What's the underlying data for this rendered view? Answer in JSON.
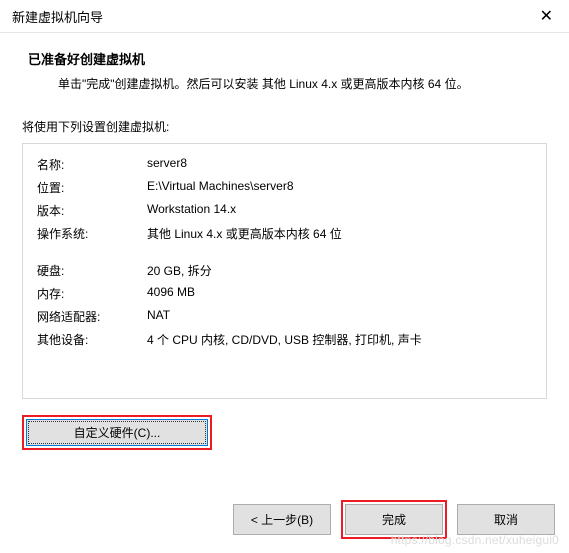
{
  "titlebar": {
    "title": "新建虚拟机向导",
    "close": "✕"
  },
  "header": {
    "title": "已准备好创建虚拟机",
    "desc": "单击\"完成\"创建虚拟机。然后可以安装 其他 Linux 4.x 或更高版本内核 64 位。"
  },
  "section_label": "将使用下列设置创建虚拟机:",
  "info": {
    "rows1": [
      {
        "label": "名称:",
        "value": "server8"
      },
      {
        "label": "位置:",
        "value": "E:\\Virtual Machines\\server8"
      },
      {
        "label": "版本:",
        "value": "Workstation 14.x"
      },
      {
        "label": "操作系统:",
        "value": "其他 Linux 4.x 或更高版本内核 64 位"
      }
    ],
    "rows2": [
      {
        "label": "硬盘:",
        "value": "20 GB, 拆分"
      },
      {
        "label": "内存:",
        "value": "4096 MB"
      },
      {
        "label": "网络适配器:",
        "value": "NAT"
      },
      {
        "label": "其他设备:",
        "value": "4 个 CPU 内核, CD/DVD, USB 控制器, 打印机, 声卡"
      }
    ]
  },
  "buttons": {
    "customize": "自定义硬件(C)...",
    "back": "< 上一步(B)",
    "finish": "完成",
    "cancel": "取消"
  },
  "watermark": "https://blog.csdn.net/xuheigui0"
}
